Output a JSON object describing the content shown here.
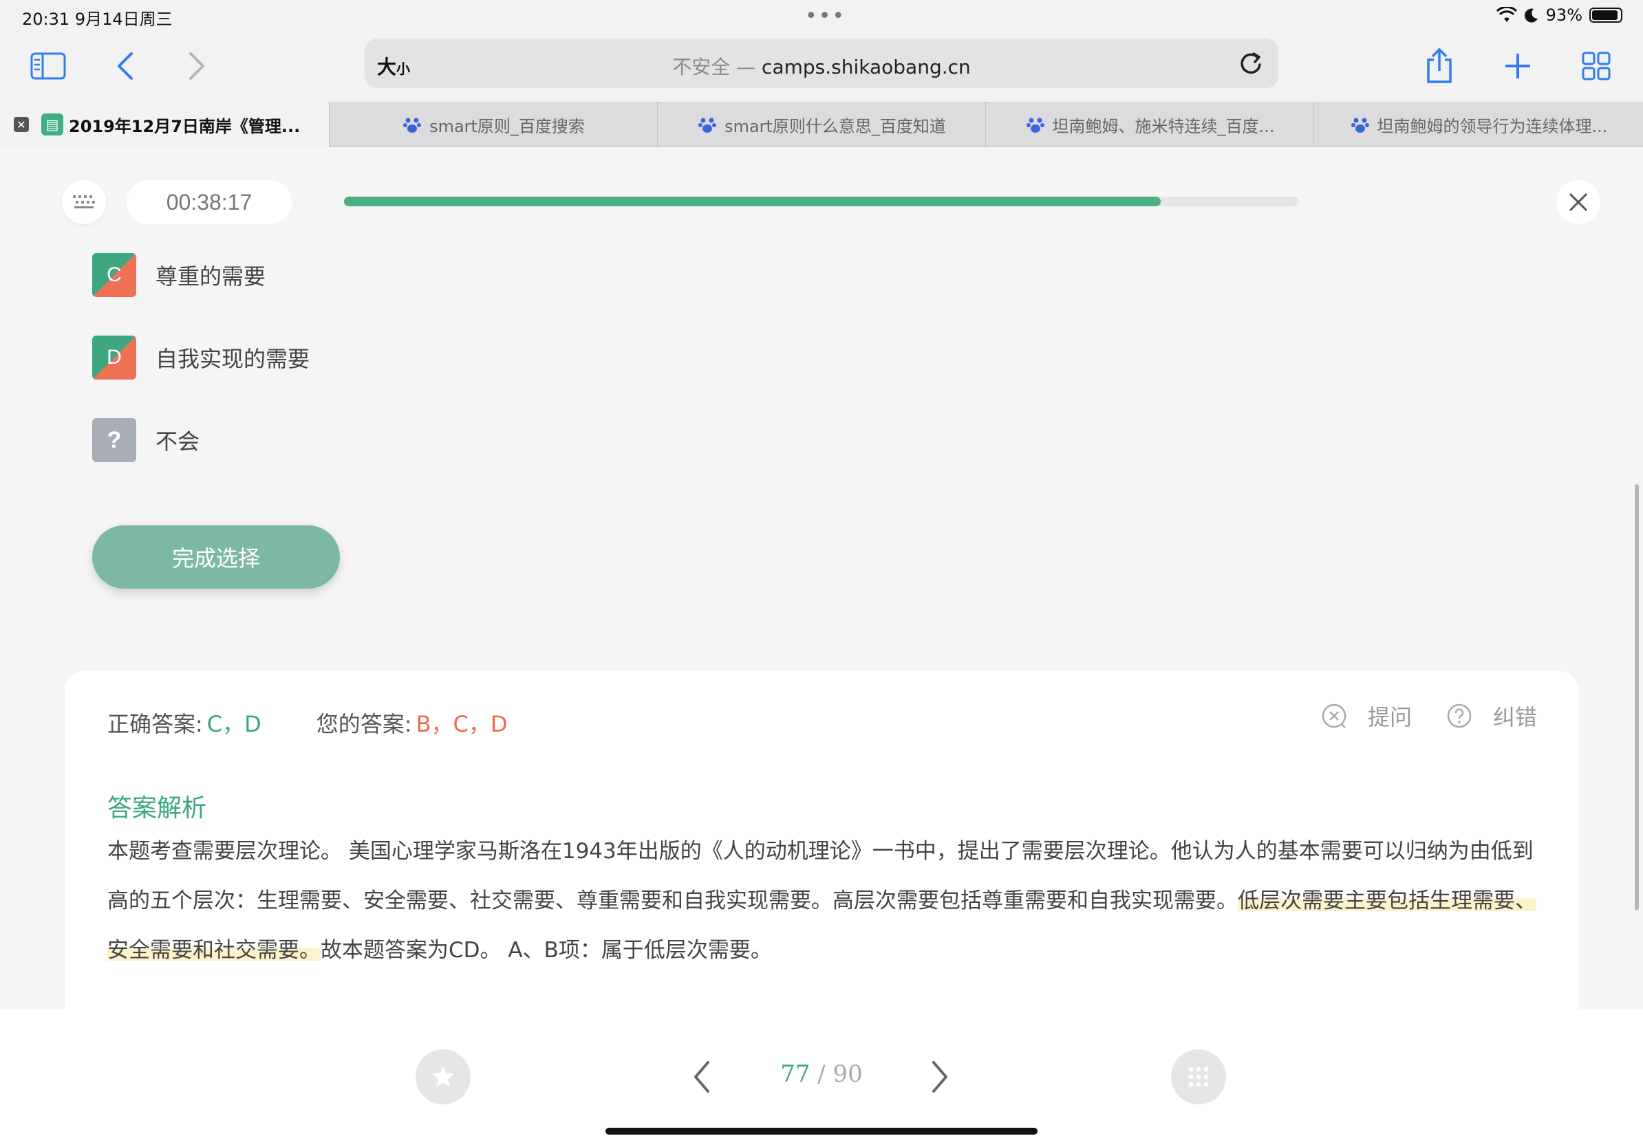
{
  "status": {
    "time": "20:31",
    "date": "9月14日周三",
    "battery": "93%",
    "battery_level": 0.93
  },
  "toolbar": {
    "aa_big": "大",
    "aa_small": "小",
    "insecure": "不安全 — ",
    "domain": "camps.shikaobang.cn",
    "icons": [
      "sidebar-icon",
      "back-icon",
      "forward-icon",
      "reload-icon",
      "share-icon",
      "new-tab-icon",
      "tab-overview-icon"
    ]
  },
  "tabs": [
    {
      "title": "2019年12月7日南岸《管理...",
      "active": true
    },
    {
      "title": "smart原则_百度搜索",
      "active": false
    },
    {
      "title": "smart原则什么意思_百度知道",
      "active": false
    },
    {
      "title": "坦南鲍姆、施米特连续_百度...",
      "active": false
    },
    {
      "title": "坦南鲍姆的领导行为连续体理...",
      "active": false
    }
  ],
  "quiz": {
    "timer": "00:38:17",
    "progress": 0.855,
    "options": [
      {
        "letter": "C",
        "label": "尊重的需要"
      },
      {
        "letter": "D",
        "label": "自我实现的需要"
      },
      {
        "letter": "?",
        "label": "不会"
      }
    ],
    "submit_label": "完成选择"
  },
  "answer": {
    "correct_label": "正确答案:",
    "correct_value": "C，D",
    "yours_label": "您的答案:",
    "yours_value": "B，C，D",
    "ask_label": "提问",
    "report_label": "纠错",
    "analysis_title": "答案解析",
    "analysis_part1": "本题考查需要层次理论。 美国心理学家马斯洛在1943年出版的《人的动机理论》一书中，提出了需要层次理论。他认为人的基本需要可以归纳为由低到高的五个层次：生理需要、安全需要、社交需要、尊重需要和自我实现需要。高层次需要包括尊重需要和自我实现需要。",
    "analysis_highlight": "低层次需要主要包括生理需要、安全需要和社交需要。",
    "analysis_part2": "故本题答案为CD。 A、B项：属于低层次需要。"
  },
  "pager": {
    "current": "77",
    "separator": " / ",
    "total": "90"
  },
  "colors": {
    "accent_green": "#3aa87c",
    "error_orange": "#ef6b4c",
    "progress_green": "#4caf82",
    "submit_bg": "#7cb8a5",
    "highlight": "#fbf3c9"
  }
}
